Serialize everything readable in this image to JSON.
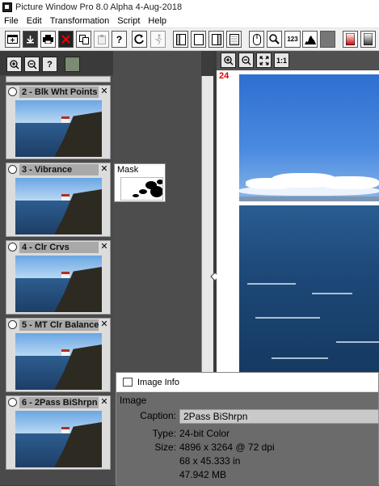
{
  "app": {
    "title": "Picture Window Pro 8.0 Alpha 4-Aug-2018"
  },
  "menu": [
    "File",
    "Edit",
    "Transformation",
    "Script",
    "Help"
  ],
  "toolbar_icons": [
    "new-icon",
    "open-icon",
    "print-icon",
    "close-red-icon",
    "copy-icon",
    "paste-icon",
    "help-icon",
    "refresh-icon",
    "run-icon",
    "panel1-icon",
    "panel2-icon",
    "panel3-icon",
    "panel4-icon",
    "mouse-icon",
    "magnifier-icon",
    "numbers-icon",
    "histogram-icon",
    "gray-icon",
    "red-gradient-icon",
    "gray-gradient-icon"
  ],
  "toolbar": {
    "help": "?",
    "numbers": "123"
  },
  "left_tools": {
    "help": "?"
  },
  "steps": [
    {
      "label": "2 - Blk Wht Points",
      "close": "✕"
    },
    {
      "label": "3 - Vibrance",
      "close": "✕"
    },
    {
      "label": "4 - Clr Crvs",
      "close": "✕"
    },
    {
      "label": "5 - MT Clr Balance",
      "close": "✕"
    },
    {
      "label": "6 - 2Pass BiShrpn",
      "close": "✕"
    }
  ],
  "mask": {
    "label": "Mask"
  },
  "image_tools": {
    "one_to_one": "1:1"
  },
  "zoom": "24",
  "image_info": {
    "title": "Image Info",
    "section": "Image",
    "caption_label": "Caption:",
    "caption_value": "2Pass BiShrpn",
    "type_label": "Type:",
    "type_value": "24-bit Color",
    "size_label": "Size:",
    "size_px": "4896 x 3264 @ 72 dpi",
    "size_in": "68 x 45.333 in",
    "size_mb": "47.942 MB"
  }
}
